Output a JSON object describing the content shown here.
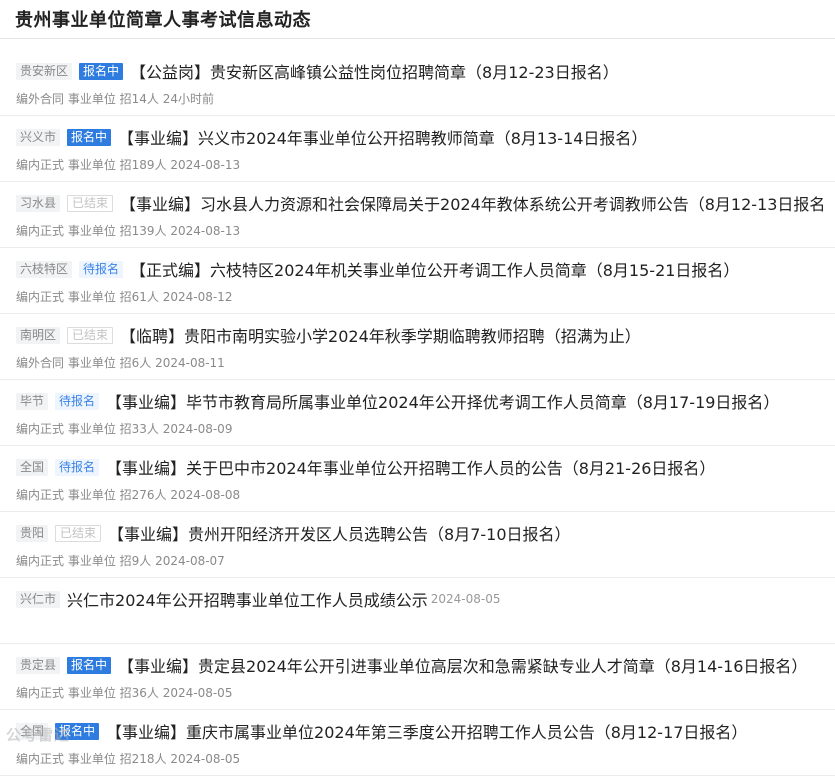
{
  "page": {
    "title": "贵州事业单位简章人事考试信息动态"
  },
  "items": [
    {
      "region": "贵安新区",
      "status": "报名中",
      "status_type": "open",
      "title": "【公益岗】贵安新区高峰镇公益性岗位招聘简章（8月12-23日报名）",
      "meta": "编外合同 事业单位 招14人 24小时前"
    },
    {
      "region": "兴义市",
      "status": "报名中",
      "status_type": "open",
      "title": "【事业编】兴义市2024年事业单位公开招聘教师简章（8月13-14日报名）",
      "meta": "编内正式 事业单位 招189人 2024-08-13"
    },
    {
      "region": "习水县",
      "status": "已结束",
      "status_type": "closed",
      "title": "【事业编】习水县人力资源和社会保障局关于2024年教体系统公开考调教师公告（8月12-13日报名",
      "meta": "编内正式 事业单位 招139人 2024-08-13"
    },
    {
      "region": "六枝特区",
      "status": "待报名",
      "status_type": "wait",
      "title": "【正式编】六枝特区2024年机关事业单位公开考调工作人员简章（8月15-21日报名）",
      "meta": "编内正式 事业单位 招61人 2024-08-12"
    },
    {
      "region": "南明区",
      "status": "已结束",
      "status_type": "closed",
      "title": "【临聘】贵阳市南明实验小学2024年秋季学期临聘教师招聘（招满为止）",
      "meta": "编外合同 事业单位 招6人 2024-08-11"
    },
    {
      "region": "毕节",
      "status": "待报名",
      "status_type": "wait",
      "title": "【事业编】毕节市教育局所属事业单位2024年公开择优考调工作人员简章（8月17-19日报名）",
      "meta": "编内正式 事业单位 招33人 2024-08-09"
    },
    {
      "region": "全国",
      "status": "待报名",
      "status_type": "wait",
      "title": "【事业编】关于巴中市2024年事业单位公开招聘工作人员的公告（8月21-26日报名）",
      "meta": "编内正式 事业单位 招276人 2024-08-08"
    },
    {
      "region": "贵阳",
      "status": "已结束",
      "status_type": "closed",
      "title": "【事业编】贵州开阳经济开发区人员选聘公告（8月7-10日报名）",
      "meta": "编内正式 事业单位 招9人 2024-08-07"
    },
    {
      "region": "兴仁市",
      "status": "",
      "status_type": "none",
      "title": "兴仁市2024年公开招聘事业单位工作人员成绩公示",
      "date_inline": "2024-08-05",
      "meta": ""
    },
    {
      "region": "贵定县",
      "status": "报名中",
      "status_type": "open",
      "title": "【事业编】贵定县2024年公开引进事业单位高层次和急需紧缺专业人才简章（8月14-16日报名）",
      "meta": "编内正式 事业单位 招36人 2024-08-05"
    },
    {
      "region": "全国",
      "status": "报名中",
      "status_type": "open",
      "title": "【事业编】重庆市属事业单位2024年第三季度公开招聘工作人员公告（8月12-17日报名）",
      "meta": "编内正式 事业单位 招218人 2024-08-05"
    }
  ],
  "watermark": "公考雷达"
}
